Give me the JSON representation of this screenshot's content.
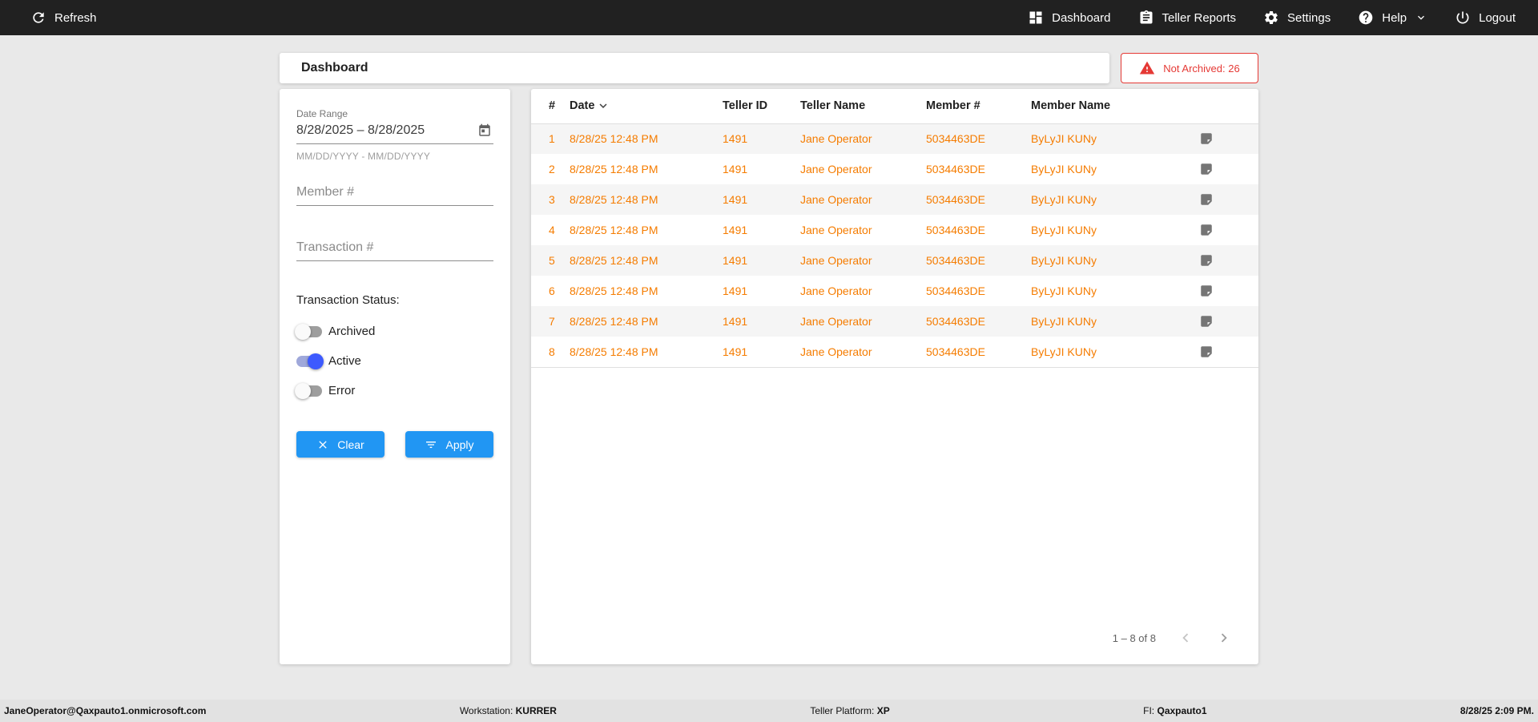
{
  "topbar": {
    "refresh_label": "Refresh",
    "nav": [
      {
        "label": "Dashboard"
      },
      {
        "label": "Teller Reports"
      },
      {
        "label": "Settings"
      },
      {
        "label": "Help"
      },
      {
        "label": "Logout"
      }
    ]
  },
  "header": {
    "title": "Dashboard",
    "not_archived_label": "Not Archived: 26"
  },
  "filters": {
    "date_range_label": "Date Range",
    "date_range_value": "8/28/2025 – 8/28/2025",
    "date_range_hint": "MM/DD/YYYY - MM/DD/YYYY",
    "member_placeholder": "Member #",
    "transaction_placeholder": "Transaction #",
    "status_label": "Transaction Status:",
    "toggles": [
      {
        "label": "Archived",
        "on": false
      },
      {
        "label": "Active",
        "on": true
      },
      {
        "label": "Error",
        "on": false
      }
    ],
    "clear_label": "Clear",
    "apply_label": "Apply"
  },
  "table": {
    "columns": [
      "#",
      "Date",
      "Teller ID",
      "Teller Name",
      "Member #",
      "Member Name"
    ],
    "rows": [
      {
        "num": "1",
        "date": "8/28/25 12:48 PM",
        "teller_id": "1491",
        "teller_name": "Jane Operator",
        "member_num": "5034463DE",
        "member_name": "ByLyJI KUNy"
      },
      {
        "num": "2",
        "date": "8/28/25 12:48 PM",
        "teller_id": "1491",
        "teller_name": "Jane Operator",
        "member_num": "5034463DE",
        "member_name": "ByLyJI KUNy"
      },
      {
        "num": "3",
        "date": "8/28/25 12:48 PM",
        "teller_id": "1491",
        "teller_name": "Jane Operator",
        "member_num": "5034463DE",
        "member_name": "ByLyJI KUNy"
      },
      {
        "num": "4",
        "date": "8/28/25 12:48 PM",
        "teller_id": "1491",
        "teller_name": "Jane Operator",
        "member_num": "5034463DE",
        "member_name": "ByLyJI KUNy"
      },
      {
        "num": "5",
        "date": "8/28/25 12:48 PM",
        "teller_id": "1491",
        "teller_name": "Jane Operator",
        "member_num": "5034463DE",
        "member_name": "ByLyJI KUNy"
      },
      {
        "num": "6",
        "date": "8/28/25 12:48 PM",
        "teller_id": "1491",
        "teller_name": "Jane Operator",
        "member_num": "5034463DE",
        "member_name": "ByLyJI KUNy"
      },
      {
        "num": "7",
        "date": "8/28/25 12:48 PM",
        "teller_id": "1491",
        "teller_name": "Jane Operator",
        "member_num": "5034463DE",
        "member_name": "ByLyJI KUNy"
      },
      {
        "num": "8",
        "date": "8/28/25 12:48 PM",
        "teller_id": "1491",
        "teller_name": "Jane Operator",
        "member_num": "5034463DE",
        "member_name": "ByLyJI KUNy"
      }
    ],
    "pagination": "1 – 8 of 8"
  },
  "footer": {
    "user": "JaneOperator@Qaxpauto1.onmicrosoft.com",
    "workstation_label": "Workstation:",
    "workstation_value": "KURRER",
    "platform_label": "Teller Platform:",
    "platform_value": "XP",
    "fi_label": "FI:",
    "fi_value": "Qaxpauto1",
    "datetime": "8/28/25 2:09 PM."
  },
  "colors": {
    "topbar_bg": "#212121",
    "accent_blue": "#2196F3",
    "row_text_orange": "#F57C00",
    "alert_red": "#E53935",
    "toggle_on_blue": "#3D5AFE"
  }
}
